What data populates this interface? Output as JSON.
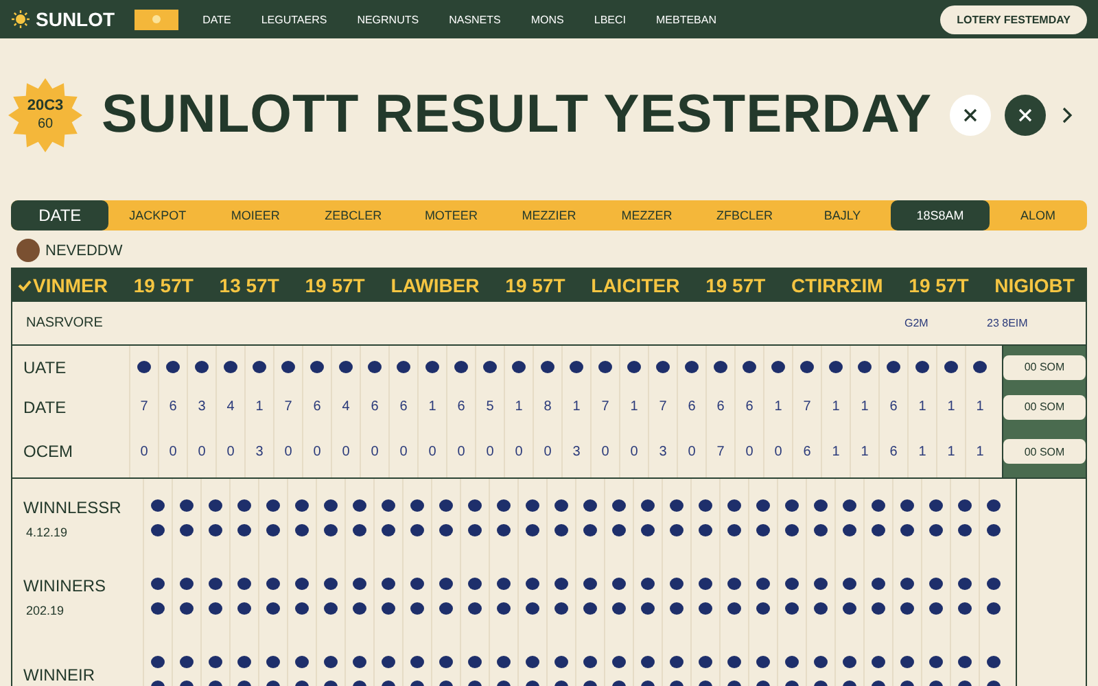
{
  "nav": {
    "logo": "SUNLOT",
    "items": [
      "DATE",
      "LEGUTAERS",
      "NEGRNUTS",
      "NASNETS",
      "MONS",
      "LBECI",
      "MEBTEBAN"
    ],
    "button": "LOTERY FESTEMDAY"
  },
  "hero": {
    "badge_lines": [
      "20C3",
      "60"
    ],
    "title": "SUNLOTT RESULT YESTERDAY"
  },
  "tabs": [
    {
      "label": "DATE",
      "selected": true
    },
    {
      "label": "JACKPOT",
      "selected": false
    },
    {
      "label": "MOIEER",
      "selected": false
    },
    {
      "label": "ZEBCLER",
      "selected": false
    },
    {
      "label": "MOTEER",
      "selected": false
    },
    {
      "label": "MEZZIER",
      "selected": false
    },
    {
      "label": "MEZZER",
      "selected": false
    },
    {
      "label": "ZFBCLER",
      "selected": false
    },
    {
      "label": "BAJLY",
      "selected": false
    },
    {
      "label": "18S8AM",
      "selected": true
    },
    {
      "label": "ALOM",
      "selected": false
    }
  ],
  "section": {
    "label": "NEVEDDW"
  },
  "table": {
    "header": [
      "VINMER",
      "19 57T",
      "13 57T",
      "19 57T",
      "LAWIBER",
      "19 57T",
      "LAICITER",
      "19 57T",
      "CTIRRΣIM",
      "19 57T",
      "NIGIOBT"
    ],
    "subheader": {
      "label": "NASRVORE",
      "column_2": "G2M",
      "column_3": "23 8EIM"
    },
    "rows": [
      {
        "kind": "dots",
        "label": "UATE",
        "side_button": "00 SOM"
      },
      {
        "kind": "digits",
        "label": "DATE",
        "values": [
          "7",
          "6",
          "3",
          "4",
          "1",
          "7",
          "6",
          "4",
          "6",
          "6",
          "1",
          "6",
          "5",
          "1",
          "8",
          "1",
          "7",
          "1",
          "7",
          "6",
          "6",
          "6",
          "1",
          "7",
          "1",
          "1",
          "6",
          "1",
          "1",
          "1"
        ],
        "side_button": "00 SOM"
      },
      {
        "kind": "digits",
        "label": "OCEM",
        "values": [
          "0",
          "0",
          "0",
          "0",
          "3",
          "0",
          "0",
          "0",
          "0",
          "0",
          "0",
          "0",
          "0",
          "0",
          "0",
          "3",
          "0",
          "0",
          "3",
          "0",
          "7",
          "0",
          "0",
          "6",
          "1",
          "1",
          "6",
          "1",
          "1",
          "1"
        ],
        "side_button": "00 SOM"
      },
      {
        "kind": "dot-pair",
        "label": "WINNLESSR",
        "sublabel": "4.12.19"
      },
      {
        "kind": "dot-pair",
        "label": "WININERS",
        "sublabel": "202.19"
      },
      {
        "kind": "dot-pair",
        "label": "WINNEIR"
      }
    ]
  }
}
